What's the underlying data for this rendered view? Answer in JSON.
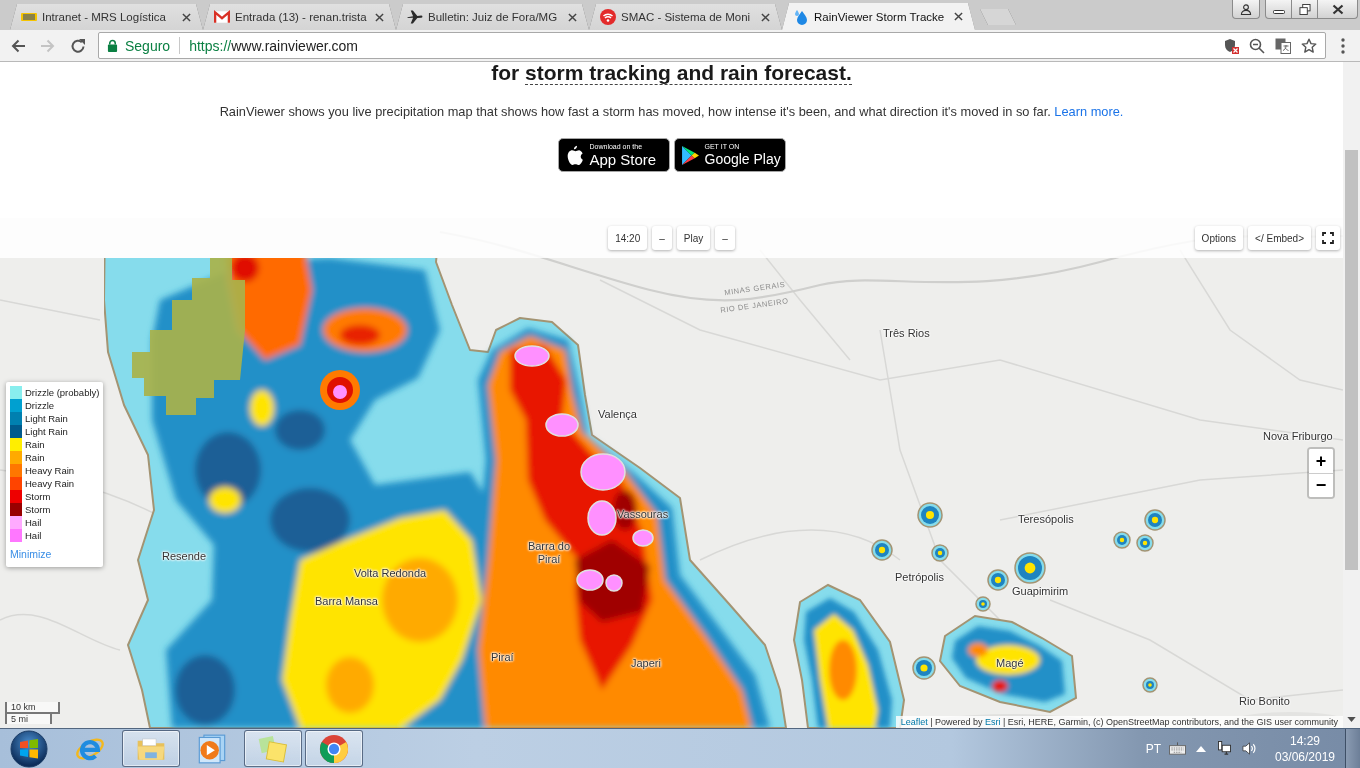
{
  "browser": {
    "tabs": [
      {
        "title": "Intranet - MRS Logística",
        "selected": false
      },
      {
        "title": "Entrada (13) - renan.trista",
        "selected": false
      },
      {
        "title": "Bulletin: Juiz de Fora/MG",
        "selected": false
      },
      {
        "title": "SMAC - Sistema de Moni",
        "selected": false
      },
      {
        "title": "RainViewer Storm Tracke",
        "selected": true
      }
    ],
    "navigation": {
      "back": {
        "disabled": false
      },
      "forward": {
        "disabled": true
      }
    },
    "address_bar": {
      "security": "Seguro",
      "url_scheme": "https://",
      "url_host": "www.rainviewer.com"
    }
  },
  "page": {
    "heading": {
      "prefix": "for",
      "underlined": "storm tracking and rain forecast."
    },
    "intro": {
      "text": "RainViewer shows you live precipitation map that shows how fast a storm has moved, how intense it's been, and what direction it's moved in so far.",
      "link": "Learn more."
    },
    "store_badges": [
      {
        "kind": "apple",
        "small": "Download on the",
        "big": "App Store"
      },
      {
        "kind": "play",
        "small": "GET IT ON",
        "big": "Google Play"
      }
    ]
  },
  "map": {
    "toolbar": {
      "left": [
        "14:20",
        "–",
        "Play",
        "–"
      ],
      "right": [
        "Options",
        "</ Embed>"
      ]
    },
    "region_labels": [
      "MINAS GERAIS",
      "RIO DE JANEIRO"
    ],
    "place_labels": [
      "Três Rios",
      "Valença",
      "Nova Friburgo",
      "Vassouras",
      "Teresópolis",
      "Resende",
      "Barra do Piraí",
      "Volta Redonda",
      "Petrópolis",
      "Guapimirim",
      "Barra Mansa",
      "Piraí",
      "Japeri",
      "Magé",
      "Rio Bonito"
    ],
    "legend": {
      "items": [
        {
          "label": "Drizzle (probably)",
          "color": "#88eeee"
        },
        {
          "label": "Drizzle",
          "color": "#00a0d0"
        },
        {
          "label": "Light Rain",
          "color": "#0080b0"
        },
        {
          "label": "Light Rain",
          "color": "#005a8c"
        },
        {
          "label": "Rain",
          "color": "#ffee00"
        },
        {
          "label": "Rain",
          "color": "#ffaa00"
        },
        {
          "label": "Heavy Rain",
          "color": "#ff7700"
        },
        {
          "label": "Heavy Rain",
          "color": "#ff4400"
        },
        {
          "label": "Storm",
          "color": "#ee0000"
        },
        {
          "label": "Storm",
          "color": "#990000"
        },
        {
          "label": "Hail",
          "color": "#ffaaff"
        },
        {
          "label": "Hail",
          "color": "#ff77ff"
        }
      ],
      "minimize": "Minimize"
    },
    "zoom": {
      "in": "+",
      "out": "−"
    },
    "scale": {
      "metric": "10 km",
      "imperial": "5 mi"
    },
    "attribution": {
      "leaflet": "Leaflet",
      "powered_by": "| Powered by",
      "esri": "Esri",
      "credits": "| Esri, HERE, Garmin, (c) OpenStreetMap contributors, and the GIS user community"
    }
  },
  "taskbar": {
    "apps": [
      {
        "kind": "ie",
        "running": false
      },
      {
        "kind": "folder",
        "running": true
      },
      {
        "kind": "player",
        "running": false
      },
      {
        "kind": "notes",
        "running": true
      },
      {
        "kind": "chrome",
        "running": true
      }
    ],
    "tray": {
      "language": "PT",
      "time": "14:29",
      "date": "03/06/2019"
    }
  }
}
